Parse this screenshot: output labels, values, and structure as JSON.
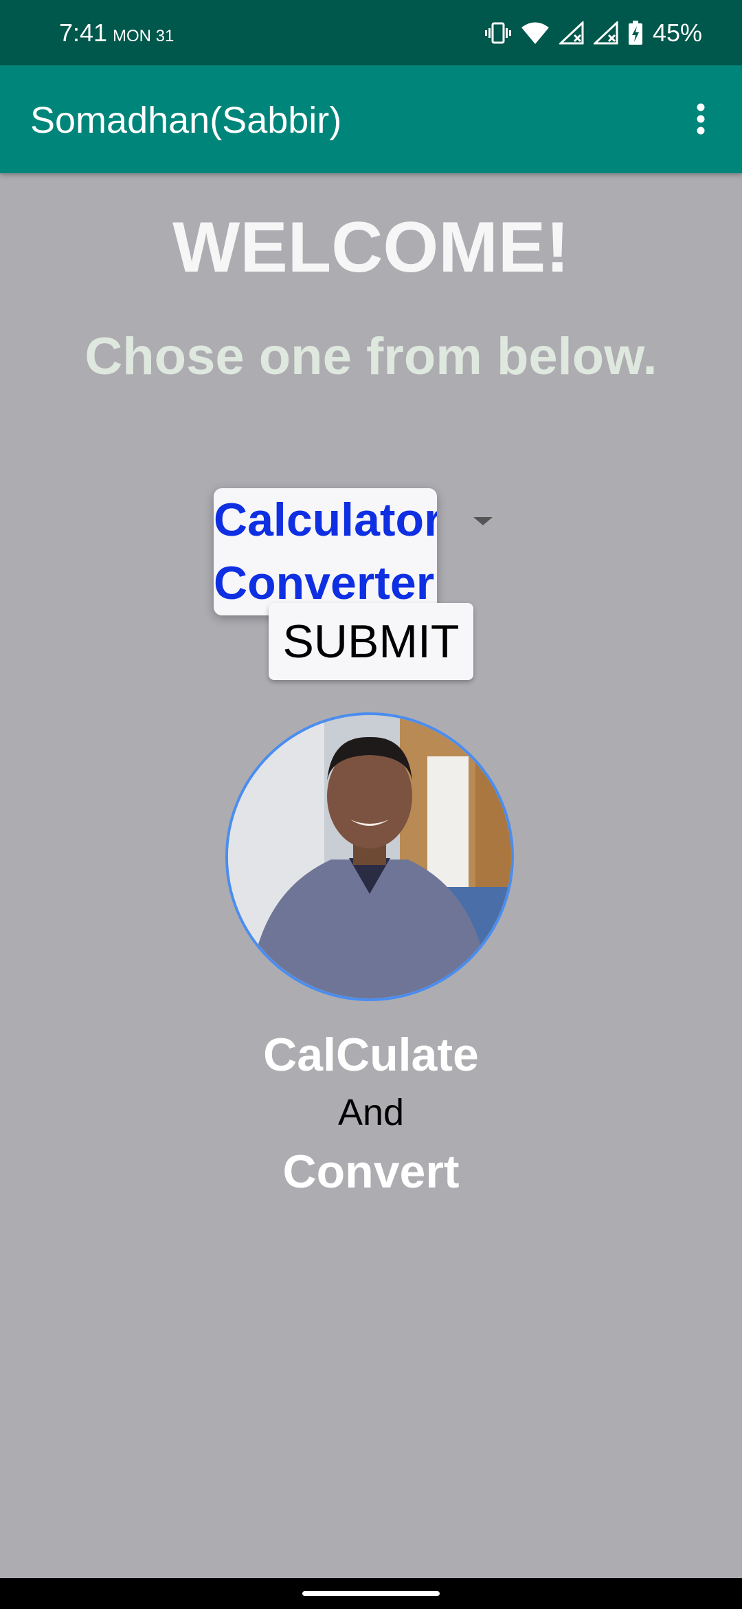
{
  "status_bar": {
    "time": "7:41",
    "date": "MON 31",
    "battery": "45%",
    "icons": [
      "vibrate-icon",
      "wifi-icon",
      "signal-icon",
      "signal-icon",
      "battery-charging-icon"
    ]
  },
  "app_bar": {
    "title": "Somadhan(Sabbir)",
    "menu_icon": "more-vert-icon"
  },
  "main": {
    "heading": "WELCOME!",
    "subheading": "Chose one from below.",
    "dropdown": {
      "options": [
        "Calculator",
        "Converter"
      ],
      "arrow_icon": "dropdown-arrow-icon"
    },
    "submit_label": "SUBMIT",
    "profile_photo": "profile-photo",
    "tagline": {
      "line1": "CalCulate",
      "line2": "And",
      "line3": "Convert"
    }
  },
  "colors": {
    "status_bar": "#00574b",
    "app_bar": "#00857a",
    "background": "#adacb1",
    "dropdown_text": "#0f2fe2",
    "subheading": "#dfe8de",
    "avatar_border": "#4a8df0"
  }
}
